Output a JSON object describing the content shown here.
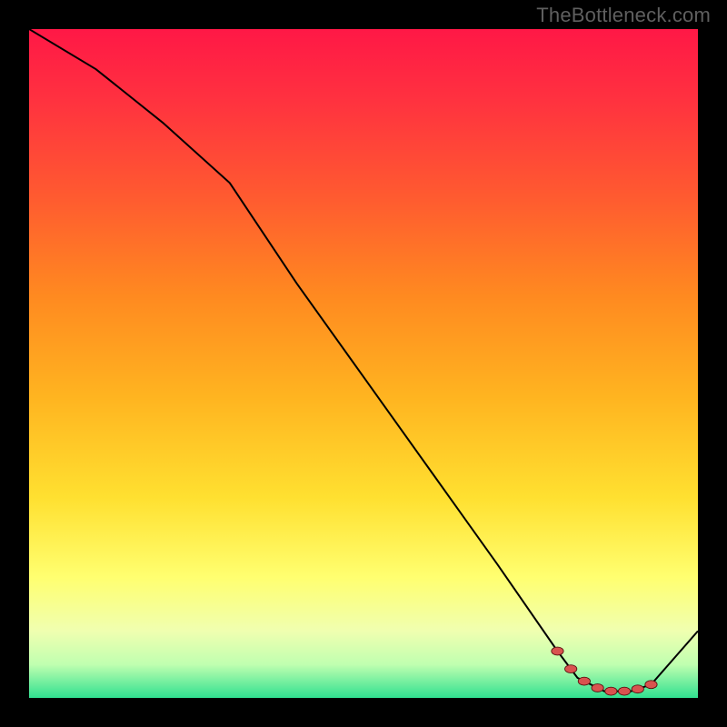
{
  "watermark": "TheBottleneck.com",
  "colors": {
    "line": "#000000",
    "marker_fill": "#d9534f",
    "marker_stroke": "#5a1010"
  },
  "chart_data": {
    "type": "line",
    "title": "",
    "xlabel": "",
    "ylabel": "",
    "xlim": [
      0,
      100
    ],
    "ylim": [
      0,
      100
    ],
    "x": [
      0,
      10,
      20,
      30,
      40,
      50,
      60,
      70,
      79,
      82,
      86,
      90,
      93,
      100
    ],
    "values": [
      0,
      6,
      14,
      23,
      38,
      52,
      66,
      80,
      93,
      97,
      99,
      99,
      98,
      90
    ],
    "marker_x": [
      79,
      81,
      83,
      85,
      87,
      89,
      91,
      93
    ]
  }
}
